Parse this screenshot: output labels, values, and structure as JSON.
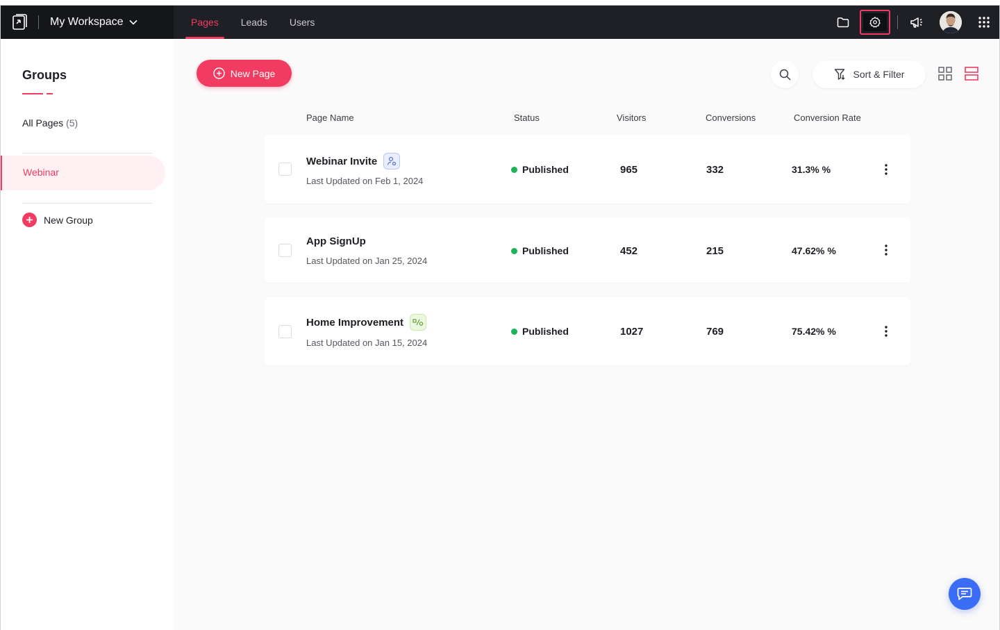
{
  "header": {
    "workspace_label": "My Workspace",
    "tabs": [
      {
        "label": "Pages"
      },
      {
        "label": "Leads"
      },
      {
        "label": "Users"
      }
    ]
  },
  "sidebar": {
    "title": "Groups",
    "all_pages_label": "All Pages",
    "all_pages_count": "(5)",
    "active_group": "Webinar",
    "new_group_label": "New Group"
  },
  "toolbar": {
    "new_page_label": "New Page",
    "sort_filter_label": "Sort & Filter"
  },
  "table": {
    "columns": [
      "Page Name",
      "Status",
      "Visitors",
      "Conversions",
      "Conversion Rate"
    ],
    "rows": [
      {
        "name": "Webinar Invite",
        "updated": "Last Updated on Feb 1, 2024",
        "status": "Published",
        "visitors": "965",
        "conversions": "332",
        "rate": "31.3% %",
        "badge": "user-icon"
      },
      {
        "name": "App SignUp",
        "updated": "Last Updated on Jan 25, 2024",
        "status": "Published",
        "visitors": "452",
        "conversions": "215",
        "rate": "47.62% %",
        "badge": ""
      },
      {
        "name": "Home Improvement",
        "updated": "Last Updated on Jan 15, 2024",
        "status": "Published",
        "visitors": "1027",
        "conversions": "769",
        "rate": "75.42% %",
        "badge": "ab-test-icon"
      }
    ]
  },
  "colors": {
    "accent": "#f13b61",
    "topbar": "#1f2025",
    "status_published": "#1cb35a",
    "chat": "#3b6cf5"
  }
}
